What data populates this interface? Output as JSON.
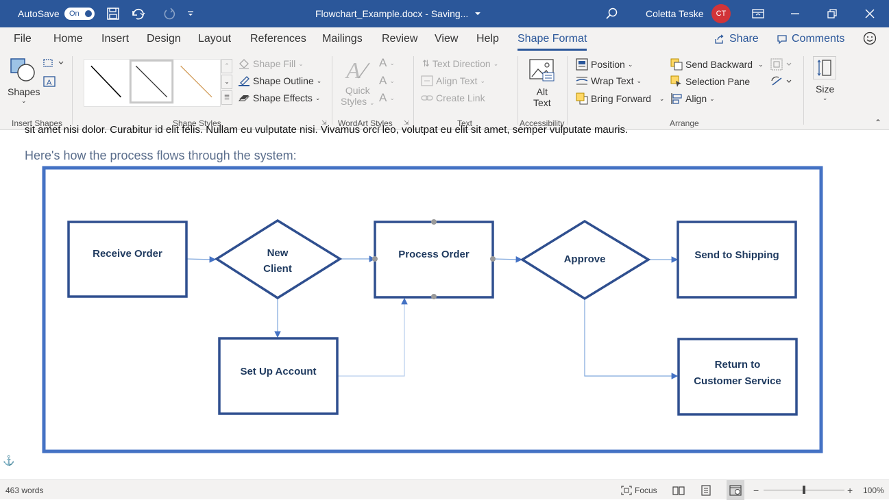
{
  "titlebar": {
    "autosave_label": "AutoSave",
    "autosave_state": "On",
    "document_title": "Flowchart_Example.docx - Saving...",
    "user_name": "Coletta Teske",
    "user_initials": "CT",
    "accent_color": "#2b579a",
    "avatar_color": "#d13438"
  },
  "tabs": [
    "File",
    "Home",
    "Insert",
    "Design",
    "Layout",
    "References",
    "Mailings",
    "Review",
    "View",
    "Help",
    "Shape Format"
  ],
  "active_tab": "Shape Format",
  "actions": {
    "share": "Share",
    "comments": "Comments"
  },
  "ribbon": {
    "insert_shapes": {
      "shapes_label": "Shapes",
      "group_label": "Insert Shapes"
    },
    "shape_styles": {
      "fill": "Shape Fill",
      "outline": "Shape Outline",
      "effects": "Shape Effects",
      "group_label": "Shape Styles"
    },
    "wordart": {
      "quick_styles_1": "Quick",
      "quick_styles_2": "Styles",
      "group_label": "WordArt Styles"
    },
    "text": {
      "direction": "Text Direction",
      "align": "Align Text",
      "link": "Create Link",
      "group_label": "Text"
    },
    "accessibility": {
      "alt_1": "Alt",
      "alt_2": "Text",
      "group_label": "Accessibility"
    },
    "arrange": {
      "position": "Position",
      "wrap": "Wrap Text",
      "forward": "Bring Forward",
      "backward": "Send Backward",
      "selection": "Selection Pane",
      "align": "Align",
      "group_label": "Arrange"
    },
    "size": {
      "label": "Size"
    }
  },
  "document": {
    "clipped_line": "sit amet nisi dolor. Curabitur id elit felis. Nullam eu vulputate nisi. Vivamus orci leo, volutpat eu elit sit amet, semper vulputate mauris.",
    "intro": "Here's how the process flows through the system:"
  },
  "flowchart": {
    "receive": "Receive Order",
    "new_client_1": "New",
    "new_client_2": "Client",
    "process": "Process Order",
    "approve": "Approve",
    "shipping": "Send to Shipping",
    "setup": "Set Up Account",
    "return_1": "Return to",
    "return_2": "Customer Service",
    "border_color": "#4472c4",
    "shape_color": "#2f4f8f"
  },
  "status": {
    "words": "463 words",
    "focus": "Focus",
    "zoom": "100%",
    "zoom_level": 1.0
  }
}
